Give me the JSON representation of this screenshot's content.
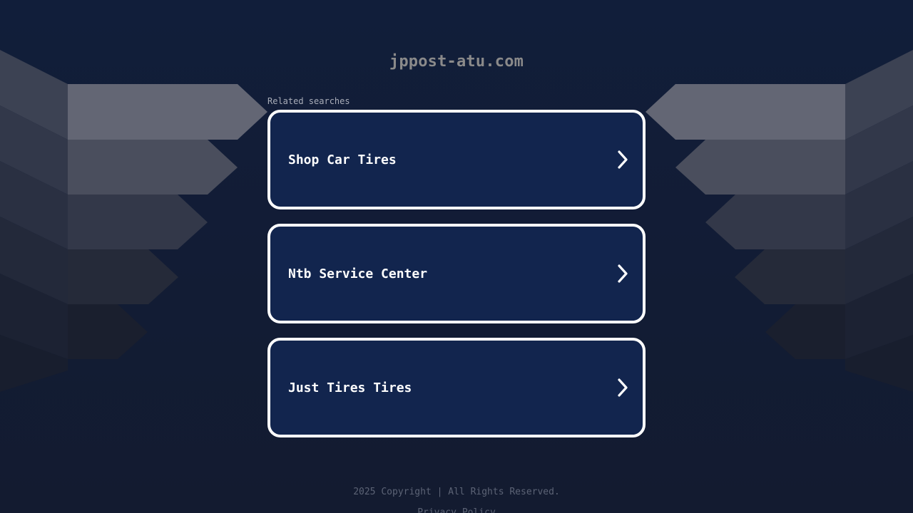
{
  "header": {
    "domain": "jppost-atu.com"
  },
  "related": {
    "heading": "Related searches",
    "items": [
      {
        "label": "Shop Car Tires",
        "icon": "chevron-right-icon"
      },
      {
        "label": "Ntb Service Center",
        "icon": "chevron-right-icon"
      },
      {
        "label": "Just Tires Tires",
        "icon": "chevron-right-icon"
      }
    ]
  },
  "footer": {
    "copyright": "2025 Copyright | All Rights Reserved.",
    "privacy": "Privacy Policy"
  },
  "colors": {
    "background": "#111d38",
    "card": "#12254e",
    "card_border": "#ffffff",
    "domain_text": "#8a8a8a"
  }
}
